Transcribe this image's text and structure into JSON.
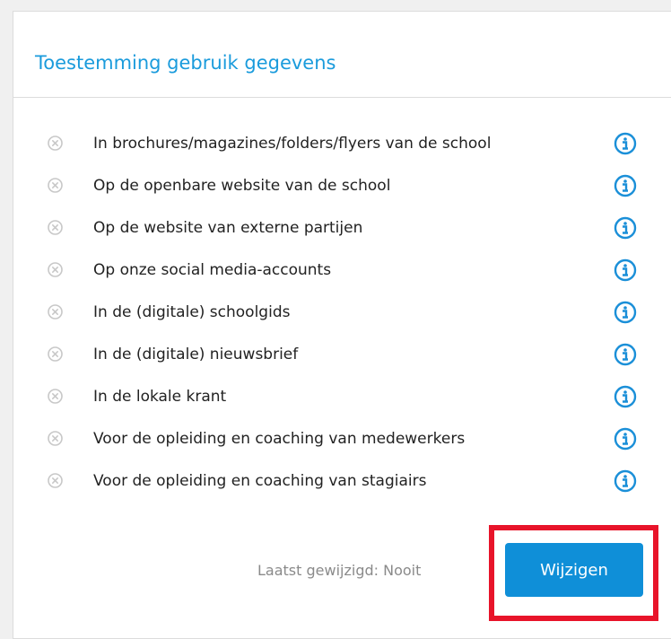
{
  "panel": {
    "title": "Toestemming gebruik gegevens"
  },
  "consent_items": [
    {
      "label": "In brochures/magazines/folders/flyers van de school",
      "status_icon": "x-circle-icon",
      "info_icon": "info-circle-icon"
    },
    {
      "label": "Op de openbare website van de school",
      "status_icon": "x-circle-icon",
      "info_icon": "info-circle-icon"
    },
    {
      "label": "Op de website van externe partijen",
      "status_icon": "x-circle-icon",
      "info_icon": "info-circle-icon"
    },
    {
      "label": "Op onze social media-accounts",
      "status_icon": "x-circle-icon",
      "info_icon": "info-circle-icon"
    },
    {
      "label": "In de (digitale) schoolgids",
      "status_icon": "x-circle-icon",
      "info_icon": "info-circle-icon"
    },
    {
      "label": "In de (digitale) nieuwsbrief",
      "status_icon": "x-circle-icon",
      "info_icon": "info-circle-icon"
    },
    {
      "label": "In de lokale krant",
      "status_icon": "x-circle-icon",
      "info_icon": "info-circle-icon"
    },
    {
      "label": "Voor de opleiding en coaching van medewerkers",
      "status_icon": "x-circle-icon",
      "info_icon": "info-circle-icon"
    },
    {
      "label": "Voor de opleiding en coaching van stagiairs",
      "status_icon": "x-circle-icon",
      "info_icon": "info-circle-icon"
    }
  ],
  "footer": {
    "last_modified": "Laatst gewijzigd: Nooit",
    "edit_button_label": "Wijzigen"
  },
  "colors": {
    "title": "#1a9bdc",
    "button_bg": "#0f8fd8",
    "button_text": "#ffffff",
    "info_icon": "#1a8fd8",
    "status_icon": "#c8c8c8",
    "highlight": "#e8142a"
  }
}
